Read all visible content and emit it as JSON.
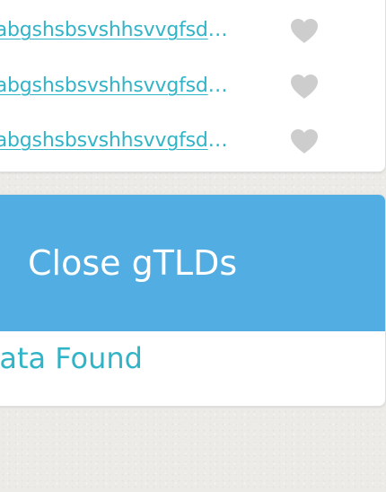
{
  "results": {
    "items": [
      {
        "domain": "nabgshsbsvshhsvvgfsdgxjhabsjdhasd"
      },
      {
        "domain": "nabgshsbsvshhsvvgfsdgxjhabsjdhasd"
      },
      {
        "domain": "nabgshsbsvshhsvvgfsdgxjhabsjdhasd"
      }
    ],
    "favorite_icon": "heart-icon",
    "favorite_icon_color": "#cdcdcd",
    "link_color": "#31b4c7"
  },
  "gtld_section": {
    "title": "Close gTLDs",
    "header_color": "#52ade3",
    "empty_message": "No Data Found"
  }
}
